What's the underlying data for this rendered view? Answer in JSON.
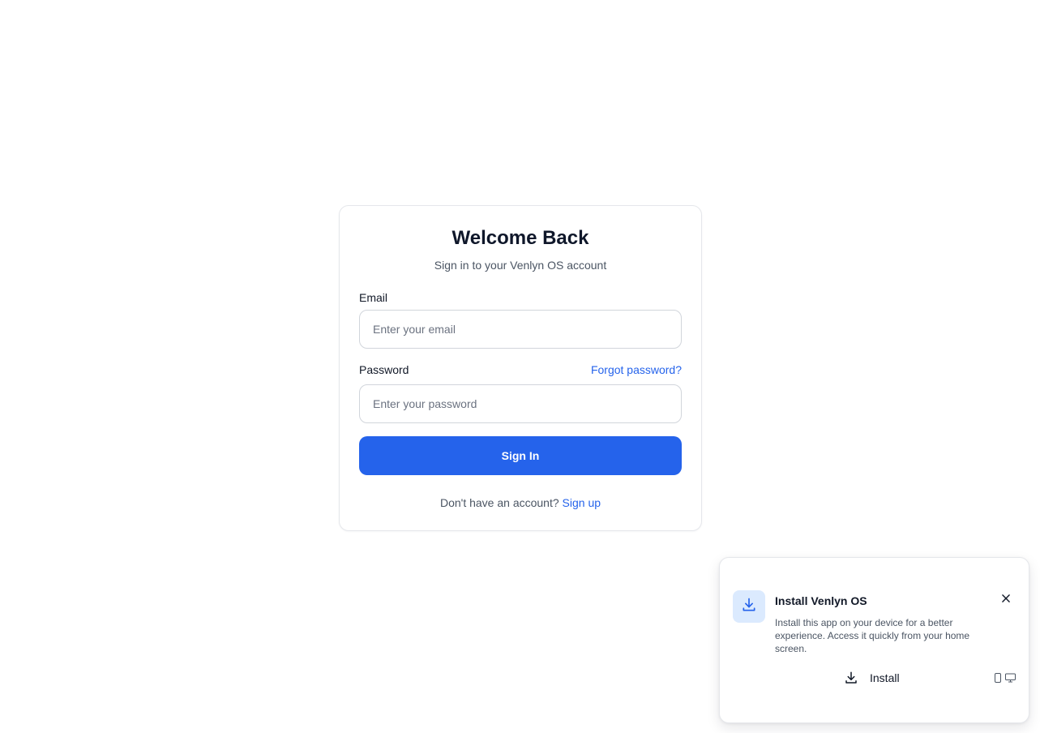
{
  "login": {
    "title": "Welcome Back",
    "subtitle": "Sign in to your Venlyn OS account",
    "email_label": "Email",
    "email_placeholder": "Enter your email",
    "email_value": "",
    "password_label": "Password",
    "forgot_password": "Forgot password?",
    "password_placeholder": "Enter your password",
    "password_value": "",
    "sign_in_button": "Sign In",
    "signup_prompt": "Don't have an account?",
    "signup_link": "Sign up"
  },
  "install_prompt": {
    "title": "Install Venlyn OS",
    "description": "Install this app on your device for a better experience. Access it quickly from your home screen.",
    "install_button": "Install",
    "icons": {
      "header": "download-icon",
      "button": "download-icon",
      "close": "close-icon",
      "devices": [
        "smartphone-icon",
        "monitor-icon"
      ]
    }
  },
  "colors": {
    "accent": "#2563eb",
    "accent_light": "#dbeafe",
    "text_primary": "#0f172a",
    "text_secondary": "#4b5563",
    "border": "#e5e7eb"
  }
}
